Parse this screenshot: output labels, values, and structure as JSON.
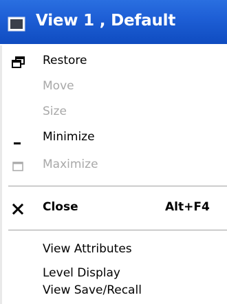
{
  "window": {
    "title": "View 1 , Default",
    "title_icon": "window-icon",
    "title_bar_color": "#1e5fd6"
  },
  "menu": {
    "items": [
      {
        "label": "Restore",
        "icon": "restore-icon",
        "enabled": true
      },
      {
        "label": "Move",
        "icon": "",
        "enabled": false
      },
      {
        "label": "Size",
        "icon": "",
        "enabled": false
      },
      {
        "label": "Minimize",
        "icon": "minimize-icon",
        "enabled": true
      },
      {
        "label": "Maximize",
        "icon": "maximize-icon",
        "enabled": false
      },
      {
        "label": "Close",
        "icon": "close-icon",
        "enabled": true,
        "bold": true,
        "shortcut": "Alt+F4"
      },
      {
        "label": "View Attributes",
        "icon": "",
        "enabled": true
      },
      {
        "label": "Level Display",
        "icon": "",
        "enabled": true
      },
      {
        "label": "View Save/Recall",
        "icon": "",
        "enabled": true
      }
    ]
  },
  "colors": {
    "disabled_text": "#a8a8a8",
    "separator": "#a0a0a0"
  }
}
